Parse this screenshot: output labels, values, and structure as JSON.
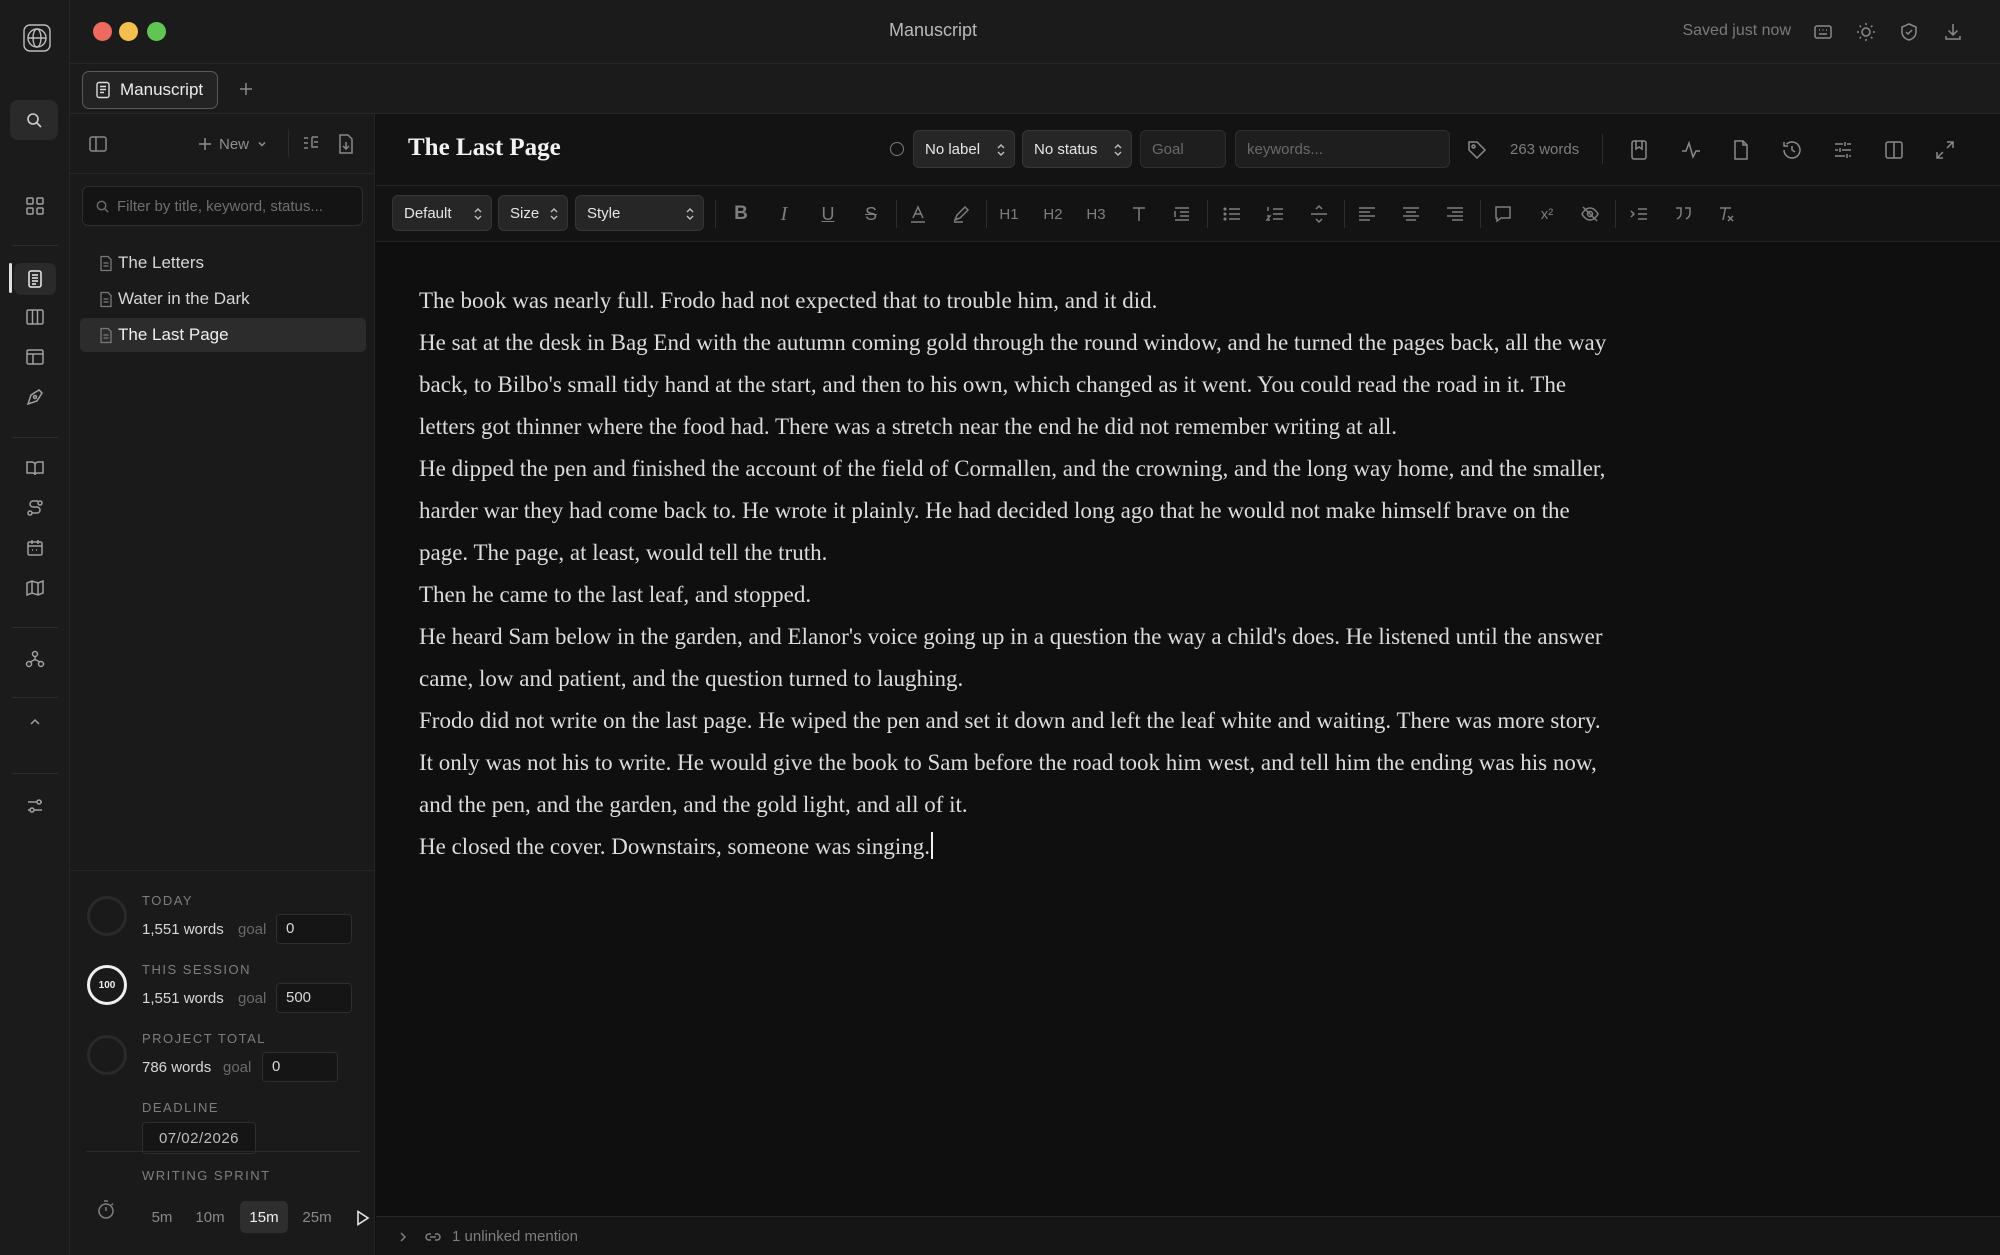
{
  "window": {
    "title": "Manuscript",
    "saved_status": "Saved just now",
    "traffic_lights": [
      "#ed6a5e",
      "#f5bf4f",
      "#61c554"
    ]
  },
  "tabs": [
    {
      "label": "Manuscript",
      "icon": "document-icon",
      "active": true
    }
  ],
  "sidebar": {
    "new_label": "New",
    "filter_placeholder": "Filter by title, keyword, status...",
    "documents": [
      {
        "title": "The Letters",
        "active": false
      },
      {
        "title": "Water in the Dark",
        "active": false
      },
      {
        "title": "The Last Page",
        "active": true
      }
    ],
    "stats": {
      "today": {
        "label": "TODAY",
        "words": "1,551 words",
        "goal_label": "goal",
        "goal": "0"
      },
      "session": {
        "label": "THIS SESSION",
        "words": "1,551 words",
        "goal_label": "goal",
        "goal": "500",
        "progress_badge": "100",
        "progress_percent": 100
      },
      "project": {
        "label": "PROJECT TOTAL",
        "words": "786 words",
        "goal_label": "goal",
        "goal": "0"
      },
      "deadline": {
        "label": "DEADLINE",
        "date": "07/02/2026"
      },
      "sprint": {
        "label": "WRITING SPRINT",
        "options": [
          "5m",
          "10m",
          "15m",
          "25m"
        ],
        "selected": "15m"
      }
    }
  },
  "document": {
    "title": "The Last Page",
    "label_select": "No label",
    "status_select": "No status",
    "goal_placeholder": "Goal",
    "keywords_placeholder": "keywords...",
    "word_count": "263 words"
  },
  "format_toolbar": {
    "paragraph_style": "Default",
    "size": "Size",
    "style": "Style",
    "headings": [
      "H1",
      "H2",
      "H3"
    ],
    "superscript": "x²"
  },
  "content": {
    "paragraphs": [
      "The book was nearly full. Frodo had not expected that to trouble him, and it did.",
      "He sat at the desk in Bag End with the autumn coming gold through the round window, and he turned the pages back, all the way back, to Bilbo's small tidy hand at the start, and then to his own, which changed as it went. You could read the road in it. The letters got thinner where the food had. There was a stretch near the end he did not remember writing at all.",
      "He dipped the pen and finished the account of the field of Cormallen, and the crowning, and the long way home, and the smaller, harder war they had come back to. He wrote it plainly. He had decided long ago that he would not make himself brave on the page. The page, at least, would tell the truth.",
      "Then he came to the last leaf, and stopped.",
      "He heard Sam below in the garden, and Elanor's voice going up in a question the way a child's does. He listened until the answer came, low and patient, and the question turned to laughing.",
      "Frodo did not write on the last page. He wiped the pen and set it down and left the leaf white and waiting. There was more story. It only was not his to write. He would give the book to Sam before the road took him west, and tell him the ending was his now, and the pen, and the garden, and the gold light, and all of it.",
      "He closed the cover. Downstairs, someone was singing."
    ]
  },
  "footer": {
    "mentions": "1 unlinked mention"
  }
}
